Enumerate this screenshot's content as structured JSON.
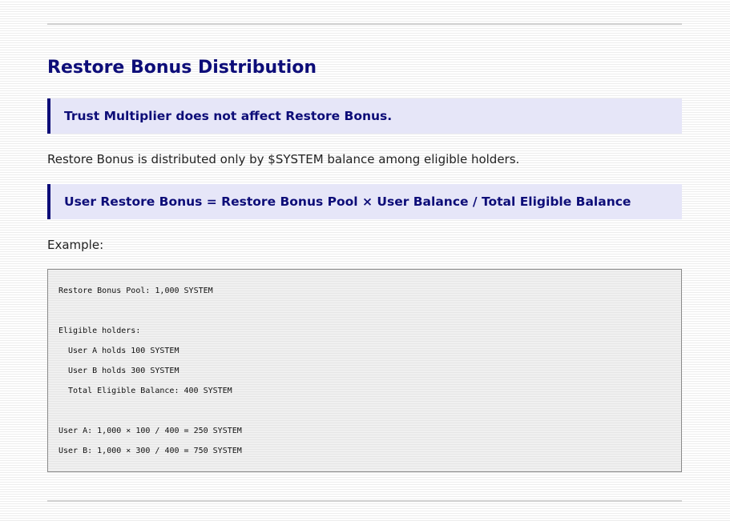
{
  "title": "Restore Bonus Distribution",
  "note": "Trust Multiplier does not affect Restore Bonus.",
  "description": "Restore Bonus is distributed only by $SYSTEM balance among eligible holders.",
  "formula": "User Restore Bonus = Restore Bonus Pool × User Balance / Total Eligible Balance",
  "example_label": "Example:",
  "code": {
    "pool": "Restore Bonus Pool: 1,000 SYSTEM",
    "holders_heading": "Eligible holders:",
    "user_a_holds": "User A holds 100 SYSTEM",
    "user_b_holds": "User B holds 300 SYSTEM",
    "total_balance": "Total Eligible Balance: 400 SYSTEM",
    "user_a_result": "User A: 1,000 × 100 / 400 = 250 SYSTEM",
    "user_b_result": "User B: 1,000 × 300 / 400 = 750 SYSTEM"
  }
}
